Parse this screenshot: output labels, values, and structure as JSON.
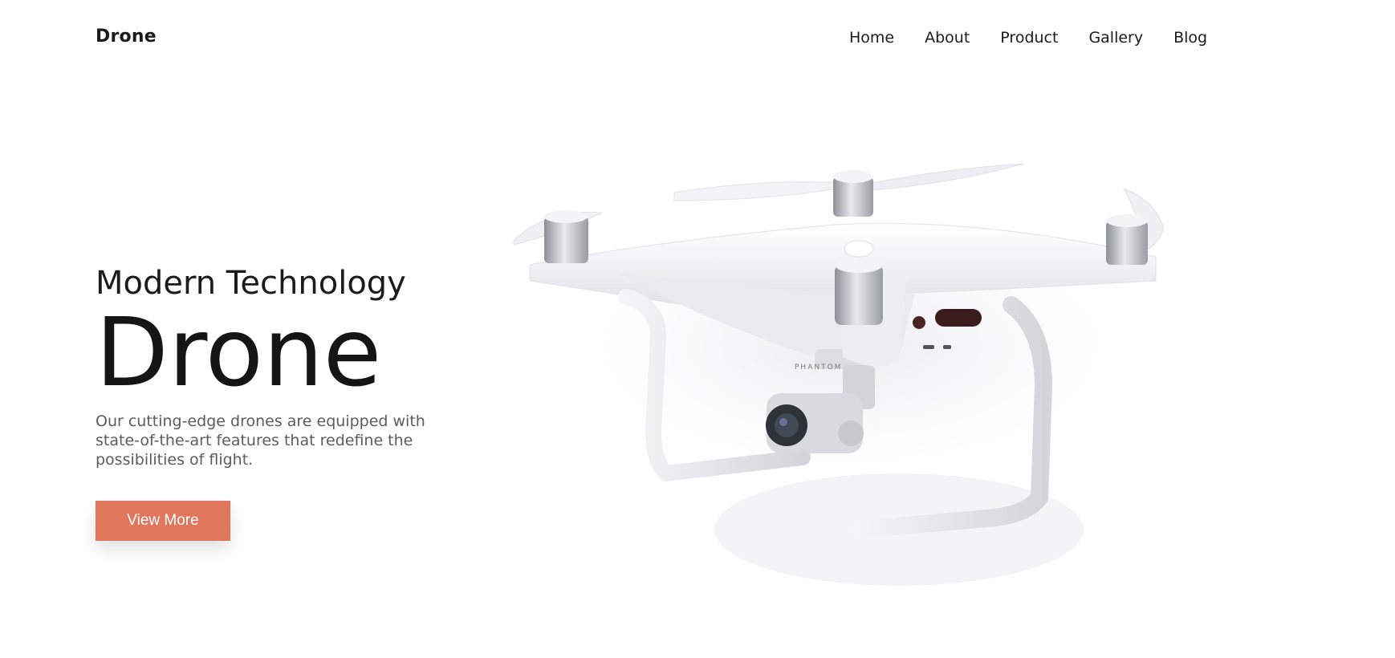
{
  "header": {
    "brand": "Drone",
    "nav": [
      "Home",
      "About",
      "Product",
      "Gallery",
      "Blog"
    ]
  },
  "hero": {
    "subtitle": "Modern Technology",
    "title": "Drone",
    "description": "Our cutting-edge drones are equipped with state-of-the-art features that redefine the possibilities of flight.",
    "cta_label": "View More",
    "image_icon": "drone-quadcopter-image",
    "image_label": "PHANTOM"
  },
  "colors": {
    "accent": "#e0775d",
    "text": "#1b1b1b",
    "muted": "#5c5c5c",
    "background": "#ffffff"
  }
}
